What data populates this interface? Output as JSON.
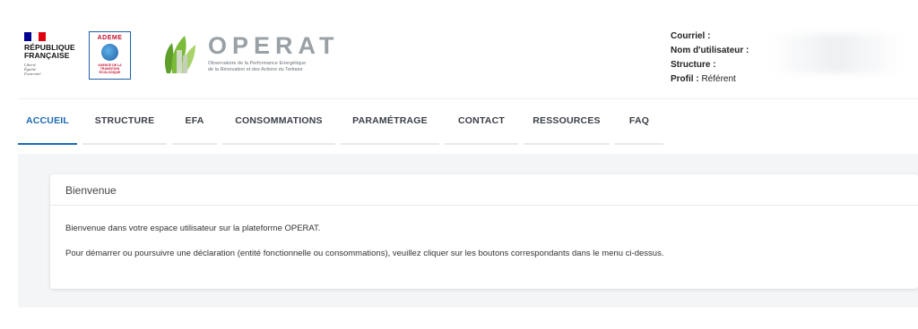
{
  "header": {
    "republique": {
      "line1": "RÉPUBLIQUE",
      "line2": "FRANÇAISE",
      "devise": [
        "Liberté",
        "Égalité",
        "Fraternité"
      ],
      "flag_colors": [
        "#000091",
        "#ffffff",
        "#e1000f"
      ]
    },
    "ademe": {
      "title": "ADEME",
      "sub": "AGENCE DE LA TRANSITION ÉCOLOGIQUE"
    },
    "operat": {
      "title": "OPERAT",
      "subtitle_line1": "Observatoire de la Performance Energétique",
      "subtitle_line2": "de la Rénovation et des Actions du Tertiaire"
    },
    "user": {
      "courriel_label": "Courriel :",
      "nom_label": "Nom d'utilisateur :",
      "structure_label": "Structure :",
      "profil_label": "Profil :",
      "profil_value": "Référent"
    }
  },
  "nav": {
    "items": [
      {
        "label": "ACCUEIL",
        "active": true
      },
      {
        "label": "STRUCTURE"
      },
      {
        "label": "EFA"
      },
      {
        "label": "CONSOMMATIONS"
      },
      {
        "label": "PARAMÉTRAGE"
      },
      {
        "label": "CONTACT"
      },
      {
        "label": "RESSOURCES"
      },
      {
        "label": "FAQ"
      }
    ]
  },
  "card": {
    "title": "Bienvenue",
    "paragraph1": "Bienvenue dans votre espace utilisateur sur la plateforme OPERAT.",
    "paragraph2": "Pour démarrer ou poursuivre une déclaration (entité fonctionnelle ou consommations), veuillez cliquer sur les boutons correspondants dans le menu ci-dessus."
  },
  "colors": {
    "accent": "#1c6ab3",
    "operat_grey": "#9aa1a6",
    "leaf_green": "#6bb02e"
  }
}
